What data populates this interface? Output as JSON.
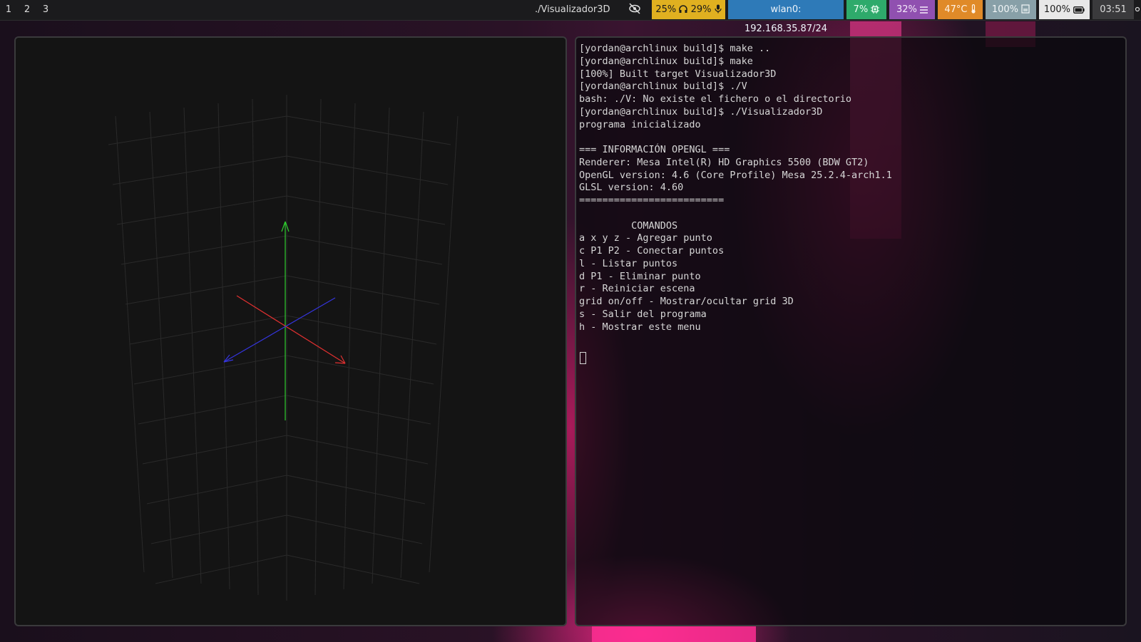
{
  "topbar": {
    "workspaces": [
      "1",
      "2",
      "3"
    ],
    "window_title": "./Visualizador3D",
    "modules": {
      "audio": "25%",
      "mic": "29%",
      "network": "wlan0: 192.168.35.87/24",
      "cpu": "7%",
      "memory": "32%",
      "temperature": "47°C",
      "backlight": "100%",
      "battery": "100%",
      "clock": "03:51"
    },
    "colors": {
      "audio": "#e0b020",
      "network": "#2e7ab8",
      "cpu": "#2eaa6b",
      "memory": "#9050b0",
      "temperature": "#e08a28",
      "backlight": "#88a0a8",
      "battery": "#e8e8e8",
      "clock": "#3a3a3c"
    }
  },
  "gl_window": {
    "axis_colors": {
      "y": "#2ecc2e",
      "x": "#e03030",
      "z": "#3535e0"
    },
    "grid_color": "#2a2a2a"
  },
  "terminal": {
    "lines": [
      "[yordan@archlinux build]$ make ..",
      "[yordan@archlinux build]$ make",
      "[100%] Built target Visualizador3D",
      "[yordan@archlinux build]$ ./V",
      "bash: ./V: No existe el fichero o el directorio",
      "[yordan@archlinux build]$ ./Visualizador3D",
      "programa inicializado",
      "",
      "=== INFORMACIÓN OPENGL ===",
      "Renderer: Mesa Intel(R) HD Graphics 5500 (BDW GT2)",
      "OpenGL version: 4.6 (Core Profile) Mesa 25.2.4-arch1.1",
      "GLSL version: 4.60",
      "=========================",
      "",
      "         COMANDOS",
      "a x y z - Agregar punto",
      "c P1 P2 - Conectar puntos",
      "l - Listar puntos",
      "d P1 - Eliminar punto",
      "r - Reiniciar escena",
      "grid on/off - Mostrar/ocultar grid 3D",
      "s - Salir del programa",
      "h - Mostrar este menu"
    ]
  }
}
